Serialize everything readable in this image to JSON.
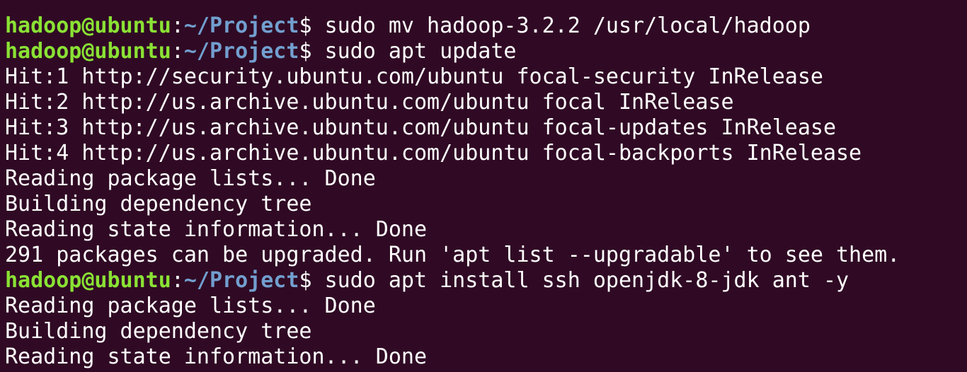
{
  "theme": {
    "background": "#300a24",
    "foreground": "#ffffff",
    "prompt_user_color": "#8ae234",
    "prompt_path_color": "#729fcf"
  },
  "prompt": {
    "user_host": "hadoop@ubuntu",
    "separator": ":",
    "path": "~/Project",
    "symbol": "$ "
  },
  "lines": [
    {
      "type": "command",
      "text": "sudo mv hadoop-3.2.2 /usr/local/hadoop"
    },
    {
      "type": "command",
      "text": "sudo apt update"
    },
    {
      "type": "output",
      "text": "Hit:1 http://security.ubuntu.com/ubuntu focal-security InRelease"
    },
    {
      "type": "output",
      "text": "Hit:2 http://us.archive.ubuntu.com/ubuntu focal InRelease"
    },
    {
      "type": "output",
      "text": "Hit:3 http://us.archive.ubuntu.com/ubuntu focal-updates InRelease"
    },
    {
      "type": "output",
      "text": "Hit:4 http://us.archive.ubuntu.com/ubuntu focal-backports InRelease"
    },
    {
      "type": "output",
      "text": "Reading package lists... Done"
    },
    {
      "type": "output",
      "text": "Building dependency tree"
    },
    {
      "type": "output",
      "text": "Reading state information... Done"
    },
    {
      "type": "output",
      "text": "291 packages can be upgraded. Run 'apt list --upgradable' to see them."
    },
    {
      "type": "command",
      "text": "sudo apt install ssh openjdk-8-jdk ant -y"
    },
    {
      "type": "output",
      "text": "Reading package lists... Done"
    },
    {
      "type": "output",
      "text": "Building dependency tree"
    },
    {
      "type": "output",
      "text": "Reading state information... Done"
    }
  ]
}
